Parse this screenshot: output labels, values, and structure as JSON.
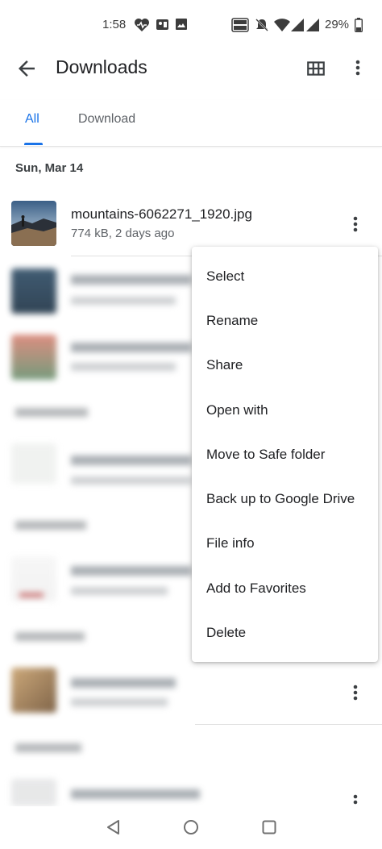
{
  "status": {
    "time": "1:58",
    "battery": "29%"
  },
  "appbar": {
    "title": "Downloads"
  },
  "tabs": [
    {
      "label": "All",
      "selected": true
    },
    {
      "label": "Download",
      "selected": false
    }
  ],
  "sections": [
    {
      "header": "Sun, Mar 14"
    }
  ],
  "files": [
    {
      "name": "mountains-6062271_1920.jpg",
      "meta": "774 kB, 2 days ago"
    }
  ],
  "menu": {
    "items": [
      "Select",
      "Rename",
      "Share",
      "Open with",
      "Move to Safe folder",
      "Back up to Google Drive",
      "File info",
      "Add to Favorites",
      "Delete"
    ]
  },
  "colors": {
    "accent": "#1a73e8"
  }
}
